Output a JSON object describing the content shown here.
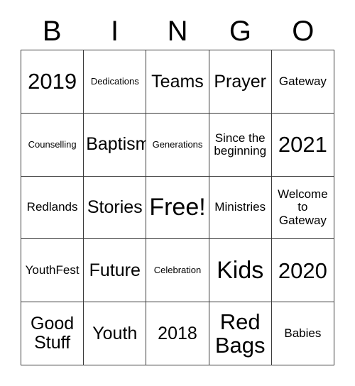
{
  "header": {
    "letters": [
      "B",
      "I",
      "N",
      "G",
      "O"
    ]
  },
  "grid": {
    "rows": 5,
    "columns": 5,
    "border_color": "#3a3a3a",
    "background_color": "#ffffff",
    "text_color": "#000000",
    "cells": [
      {
        "text": "2019",
        "size": "lg"
      },
      {
        "text": "Dedications",
        "size": "xs"
      },
      {
        "text": "Teams",
        "size": "md"
      },
      {
        "text": "Prayer",
        "size": "md"
      },
      {
        "text": "Gateway",
        "size": "sm"
      },
      {
        "text": "Counselling",
        "size": "xs"
      },
      {
        "text": "Baptism",
        "size": "md"
      },
      {
        "text": "Generations",
        "size": "xs"
      },
      {
        "text": "Since the\nbeginning",
        "size": "sm"
      },
      {
        "text": "2021",
        "size": "lg"
      },
      {
        "text": "Redlands",
        "size": "sm"
      },
      {
        "text": "Stories",
        "size": "md"
      },
      {
        "text": "Free!",
        "size": "xl"
      },
      {
        "text": "Ministries",
        "size": "sm"
      },
      {
        "text": "Welcome\nto\nGateway",
        "size": "sm"
      },
      {
        "text": "YouthFest",
        "size": "sm"
      },
      {
        "text": "Future",
        "size": "md"
      },
      {
        "text": "Celebration",
        "size": "xs"
      },
      {
        "text": "Kids",
        "size": "xl"
      },
      {
        "text": "2020",
        "size": "lg"
      },
      {
        "text": "Good\nStuff",
        "size": "md"
      },
      {
        "text": "Youth",
        "size": "md"
      },
      {
        "text": "2018",
        "size": "md"
      },
      {
        "text": "Red\nBags",
        "size": "lg"
      },
      {
        "text": "Babies",
        "size": "sm"
      }
    ]
  }
}
